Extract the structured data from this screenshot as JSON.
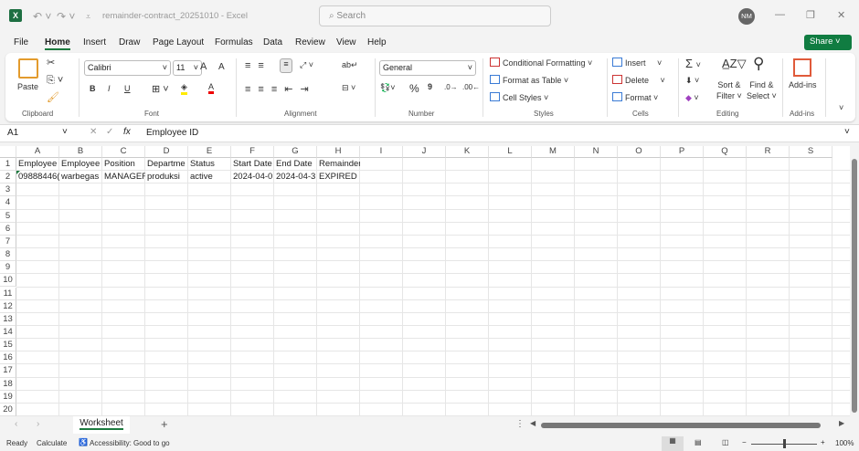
{
  "window": {
    "doc_title": "remainder-contract_20251010  -  Excel",
    "search_placeholder": "Search",
    "avatar": "NM",
    "app_icon": "X"
  },
  "menu": [
    "File",
    "Home",
    "Insert",
    "Draw",
    "Page Layout",
    "Formulas",
    "Data",
    "Review",
    "View",
    "Help"
  ],
  "share_label": "Share",
  "ribbon": {
    "clipboard": {
      "paste": "Paste",
      "group": "Clipboard"
    },
    "font": {
      "name": "Calibri",
      "size": "11",
      "bold": "B",
      "italic": "I",
      "underline": "U",
      "group": "Font",
      "grow": "A",
      "shrink": "A"
    },
    "alignment": {
      "group": "Alignment"
    },
    "number": {
      "format": "General",
      "percent": "%",
      "comma": "9",
      "group": "Number"
    },
    "styles": {
      "conditional": "Conditional Formatting",
      "table": "Format as Table",
      "cell_styles": "Cell Styles",
      "group": "Styles"
    },
    "cells": {
      "insert": "Insert",
      "delete": "Delete",
      "format": "Format",
      "group": "Cells"
    },
    "editing": {
      "sum": "Σ",
      "sort1": "Sort &",
      "sort2": "Filter",
      "find1": "Find &",
      "find2": "Select",
      "group": "Editing"
    },
    "addins": {
      "label": "Add-ins",
      "group": "Add-ins"
    }
  },
  "formula_bar": {
    "name_box": "A1",
    "fx": "fx",
    "value": "Employee ID"
  },
  "columns": [
    "A",
    "B",
    "C",
    "D",
    "E",
    "F",
    "G",
    "H",
    "I",
    "J",
    "K",
    "L",
    "M",
    "N",
    "O",
    "P",
    "Q",
    "R",
    "S"
  ],
  "rows": [
    "1",
    "2",
    "3",
    "4",
    "5",
    "6",
    "7",
    "8",
    "9",
    "10",
    "11",
    "12",
    "13",
    "14",
    "15",
    "16",
    "17",
    "18",
    "19",
    "20"
  ],
  "cells": [
    [
      "Employee ID",
      "Employee",
      "Position",
      "Departme",
      "Status",
      "Start Date",
      "End Date",
      "Remainder"
    ],
    [
      "09888446(",
      "warbegas",
      "MANAGEF",
      "produksi",
      "active",
      "2024-04-0",
      "2024-04-3",
      "EXPIRED"
    ]
  ],
  "sheet_tabs": [
    "Worksheet"
  ],
  "status": {
    "ready": "Ready",
    "calculate": "Calculate",
    "accessibility": "Accessibility: Good to go",
    "zoom": "100%"
  }
}
